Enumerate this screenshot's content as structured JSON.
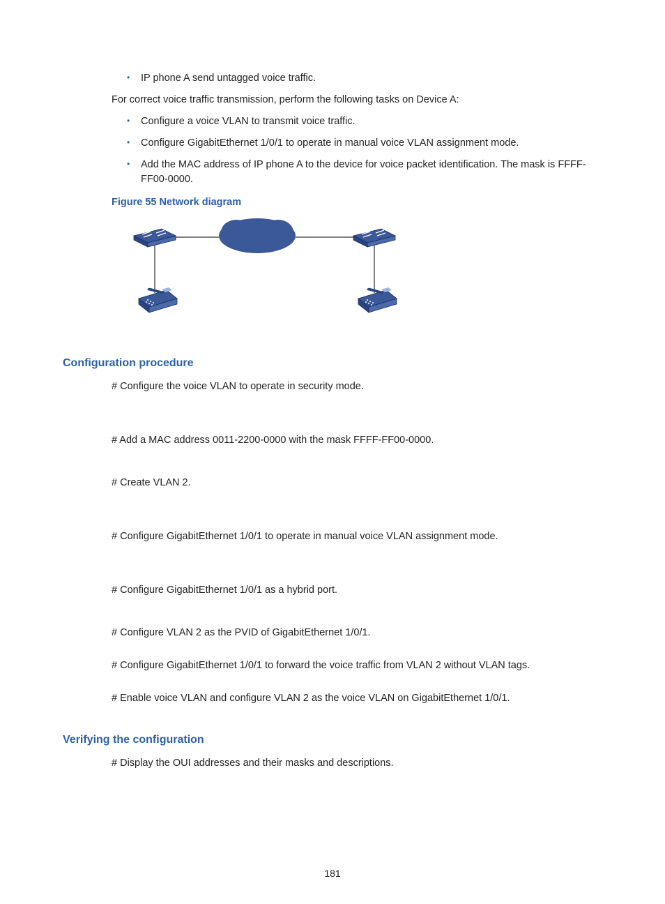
{
  "top_bullets": [
    "IP phone A send untagged voice traffic."
  ],
  "intro_para": "For correct voice traffic transmission, perform the following tasks on Device A:",
  "task_bullets": [
    "Configure a voice VLAN to transmit voice traffic.",
    "Configure GigabitEthernet 1/0/1 to operate in manual voice VLAN assignment mode.",
    "Add the MAC address of IP phone A to the device for voice packet identification. The mask is FFFF-FF00-0000."
  ],
  "figure_caption": "Figure 55 Network diagram",
  "section_config": "Configuration procedure",
  "steps": [
    "# Configure the voice VLAN to operate in security mode.",
    "# Add a MAC address 0011-2200-0000 with the mask FFFF-FF00-0000.",
    "# Create VLAN 2.",
    "# Configure GigabitEthernet 1/0/1 to operate in manual voice VLAN assignment mode.",
    "# Configure GigabitEthernet 1/0/1 as a hybrid port.",
    "# Configure VLAN 2 as the PVID of GigabitEthernet 1/0/1.",
    "# Configure GigabitEthernet 1/0/1 to forward the voice traffic from VLAN 2 without VLAN tags.",
    "# Enable voice VLAN and configure VLAN 2 as the voice VLAN on GigabitEthernet 1/0/1."
  ],
  "section_verify": "Verifying the configuration",
  "verify_step": "# Display the OUI addresses and their masks and descriptions.",
  "page_number": "181"
}
